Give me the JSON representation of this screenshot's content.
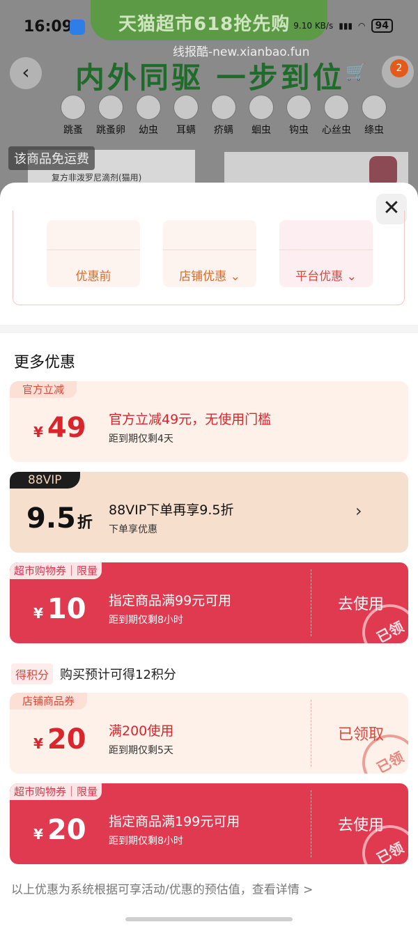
{
  "status_bar": {
    "time": "16:09",
    "speed": "9.10 KB/s",
    "battery": "94"
  },
  "background_page": {
    "banner": "天猫超市618抢先购",
    "watermark": "线报酷-new.xianbao.fun",
    "heading": "内外同驱 一步到位",
    "cart_badge": "2",
    "pests": [
      "跳蚤",
      "跳蚤卵",
      "幼虫",
      "耳螨",
      "疥螨",
      "蛔虫",
      "钩虫",
      "心丝虫",
      "绦虫"
    ],
    "free_shipping": "该商品免运费",
    "product_box_text": "复方非泼罗尼滴剂(猫用)"
  },
  "sheet": {
    "close_symbol": "✕",
    "breakdown": [
      {
        "label": "优惠前"
      },
      {
        "label": "店铺优惠",
        "chevron": "⌄"
      },
      {
        "label": "平台优惠",
        "chevron": "⌄"
      }
    ],
    "section_title": "更多优惠",
    "coupons": [
      {
        "tag": "官方立减",
        "yen": "¥",
        "amount": "49",
        "unit": "",
        "title": "官方立减49元，无使用门槛",
        "sub": "距到期仅剩4天",
        "action": "",
        "stamp": ""
      },
      {
        "tag": "88VIP",
        "yen": "",
        "amount": "9.5",
        "unit": "折",
        "title": "88VIP下单再享9.5折",
        "sub": "下单享优惠",
        "action": "",
        "stamp": "",
        "chevron": "›"
      },
      {
        "tag": "超市购物券｜限量",
        "yen": "¥",
        "amount": "10",
        "unit": "",
        "title": "指定商品满99元可用",
        "sub": "距到期仅剩8小时",
        "action": "去使用",
        "stamp": "已领"
      },
      {
        "tag": "店铺商品券",
        "yen": "¥",
        "amount": "20",
        "unit": "",
        "title": "满200使用",
        "sub": "距到期仅剩5天",
        "action": "已领取",
        "stamp": "已领"
      },
      {
        "tag": "超市购物券｜限量",
        "yen": "¥",
        "amount": "20",
        "unit": "",
        "title": "指定商品满199元可用",
        "sub": "距到期仅剩8小时",
        "action": "去使用",
        "stamp": "已领"
      }
    ],
    "points": {
      "tag": "得积分",
      "text": "购买预计可得12积分"
    },
    "footnote": "以上优惠为系统根据可享活动/优惠的预估值，查看详情 >"
  }
}
